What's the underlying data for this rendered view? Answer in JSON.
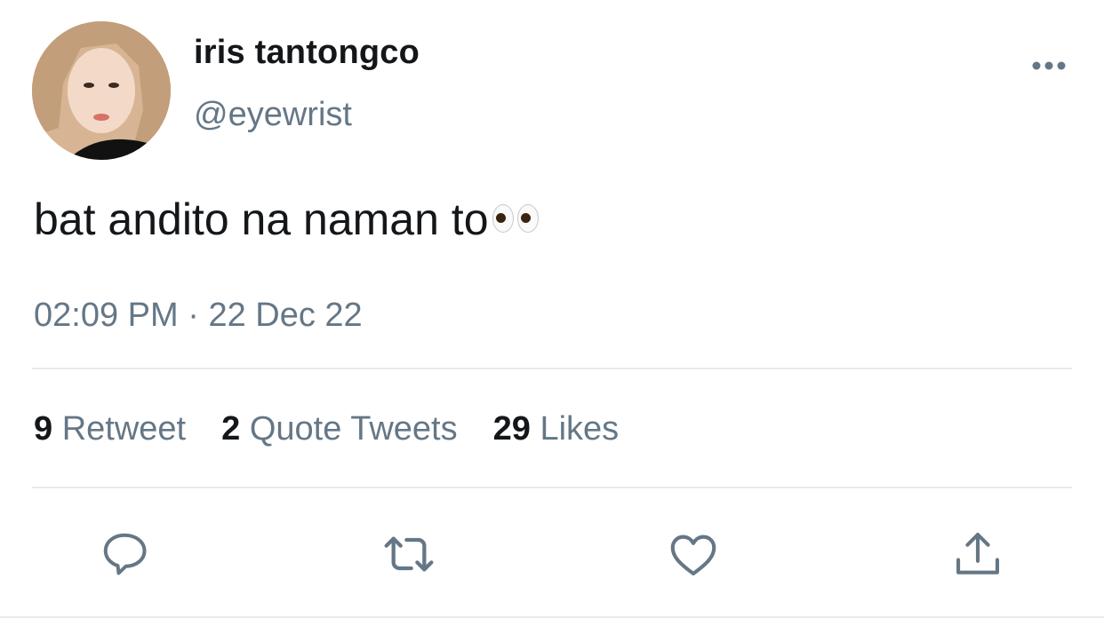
{
  "tweet": {
    "author": {
      "display_name": "iris tantongco",
      "handle": "@eyewrist"
    },
    "text": "bat andito na naman to",
    "emoji_icon": "eyes-emoji",
    "time": "02:09 PM",
    "separator": "·",
    "date": "22 Dec 22",
    "stats": [
      {
        "count": "9",
        "label": "Retweet"
      },
      {
        "count": "2",
        "label": "Quote Tweets"
      },
      {
        "count": "29",
        "label": "Likes"
      }
    ],
    "actions": [
      "reply-icon",
      "retweet-icon",
      "like-icon",
      "share-icon"
    ]
  },
  "colors": {
    "text_primary": "#14171a",
    "text_secondary": "#657786",
    "divider": "#e6ecf0",
    "icon": "#657786"
  }
}
